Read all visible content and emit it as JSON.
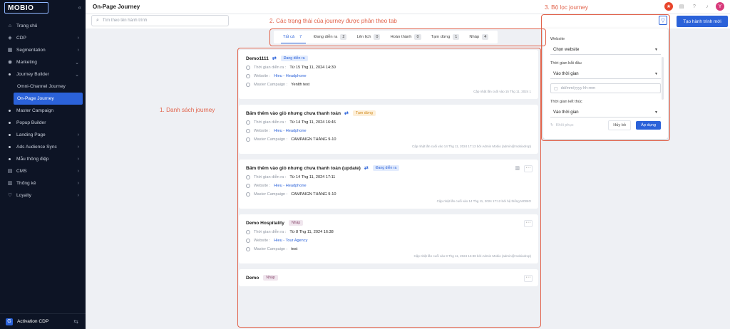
{
  "app": {
    "title": "On-Page Journey",
    "logo": "MOBIO",
    "bottom_label": "Activation CDP",
    "avatar": "Y"
  },
  "sidebar": {
    "items": [
      {
        "label": "Trang chủ",
        "icon": "home-icon",
        "level": 0
      },
      {
        "label": "CDP",
        "icon": "cdp-icon",
        "level": 0,
        "chev": "›"
      },
      {
        "label": "Segmentation",
        "icon": "segment-icon",
        "level": 0,
        "chev": "›"
      },
      {
        "label": "Marketing",
        "icon": "marketing-icon",
        "level": 0,
        "chev": "⌄"
      },
      {
        "label": "Journey Builder",
        "level": 1,
        "chev": "⌄"
      },
      {
        "label": "Omni-Channel Journey",
        "level": 2
      },
      {
        "label": "On-Page Journey",
        "level": 2,
        "active": true
      },
      {
        "label": "Master Campaign",
        "level": 1
      },
      {
        "label": "Popup Builder",
        "level": 1
      },
      {
        "label": "Landing Page",
        "level": 1,
        "chev": "›"
      },
      {
        "label": "Ads Audience Sync",
        "level": 1,
        "chev": "›"
      },
      {
        "label": "Mẫu thông điệp",
        "level": 1,
        "chev": "›"
      },
      {
        "label": "CMS",
        "icon": "cms-icon",
        "level": 0,
        "chev": "›"
      },
      {
        "label": "Thống kê",
        "icon": "stats-icon",
        "level": 0,
        "chev": "›"
      },
      {
        "label": "Loyalty",
        "icon": "loyalty-icon",
        "level": 0,
        "chev": "›"
      }
    ]
  },
  "search": {
    "placeholder": "Tìm theo tên hành trình"
  },
  "create_button": "Tạo hành trình mới",
  "tabs": [
    {
      "label": "Tất cả",
      "count": "7",
      "active": true
    },
    {
      "label": "Đang diễn ra",
      "count": "2"
    },
    {
      "label": "Lên lịch",
      "count": "0"
    },
    {
      "label": "Hoàn thành",
      "count": "0"
    },
    {
      "label": "Tạm dừng",
      "count": "1"
    },
    {
      "label": "Nháp",
      "count": "4"
    }
  ],
  "labels": {
    "time": "Thời gian diễn ra :",
    "website": "Website :",
    "campaign": "Master Campaign :"
  },
  "journeys": [
    {
      "name": "Demo1111",
      "status": "Đang diễn ra",
      "status_type": "running",
      "time": "Từ 15 Thg 11, 2024 14:30",
      "website": "Hieu - Headphone",
      "campaign": "Yenlth test",
      "updated": "Cập nhật lần cuối vào 15 Thg 11, 2024 1"
    },
    {
      "name": "Bấm thêm vào giỏ nhưng chưa thanh toán",
      "status": "Tạm dừng",
      "status_type": "paused",
      "time": "Từ 14 Thg 11, 2024 16:46",
      "website": "Hieu - Headphone",
      "campaign": "CAMPAIGN THÁNG 9-10",
      "updated": "Cập nhật lần cuối vào 14 Thg 11, 2024 17:12 bởi Admin Mobio (admin@mobiodrop)"
    },
    {
      "name": "Bấm thêm vào giỏ nhưng chưa thanh toán (update)",
      "status": "Đang diễn ra",
      "status_type": "running",
      "time": "Từ 14 Thg 11, 2024 17:11",
      "website": "Hieu - Headphone",
      "campaign": "CAMPAIGN THÁNG 9-10",
      "updated": "Cập nhật lần cuối vào 14 Thg 11, 2024 17:12 bởi hệ thống MOBIO"
    },
    {
      "name": "Demo Hospitality",
      "status": "Nháp",
      "status_type": "draft",
      "time": "Từ 8 Thg 11, 2024 16:38",
      "website": "Hieu - Tour Agency",
      "campaign": "test",
      "updated": "Cập nhật lần cuối vào 8 Thg 11, 2024 16:38 bởi Admin Mobio (admin@mobiodrop)"
    },
    {
      "name": "Demo",
      "status": "Nháp",
      "status_type": "draft"
    }
  ],
  "filter": {
    "website_label": "Website",
    "website_value": "Chọn website",
    "start_label": "Thời gian bắt đầu",
    "start_value": "Vào thời gian",
    "date_placeholder": "dd/mm/yyyy hh:mm",
    "end_label": "Thời gian kết thúc",
    "end_value": "Vào thời gian",
    "reset": "Khôi phục",
    "cancel": "Hủy bỏ",
    "apply": "Áp dụng"
  },
  "annotations": {
    "list": "1. Danh sách journey",
    "tabs": "2. Các trạng thái của journey được phân theo tab",
    "filter": "3. Bộ lọc journey"
  },
  "colors": {
    "accent": "#2b62d9",
    "annotation": "#e1624a",
    "sidebar": "#0d1425"
  }
}
